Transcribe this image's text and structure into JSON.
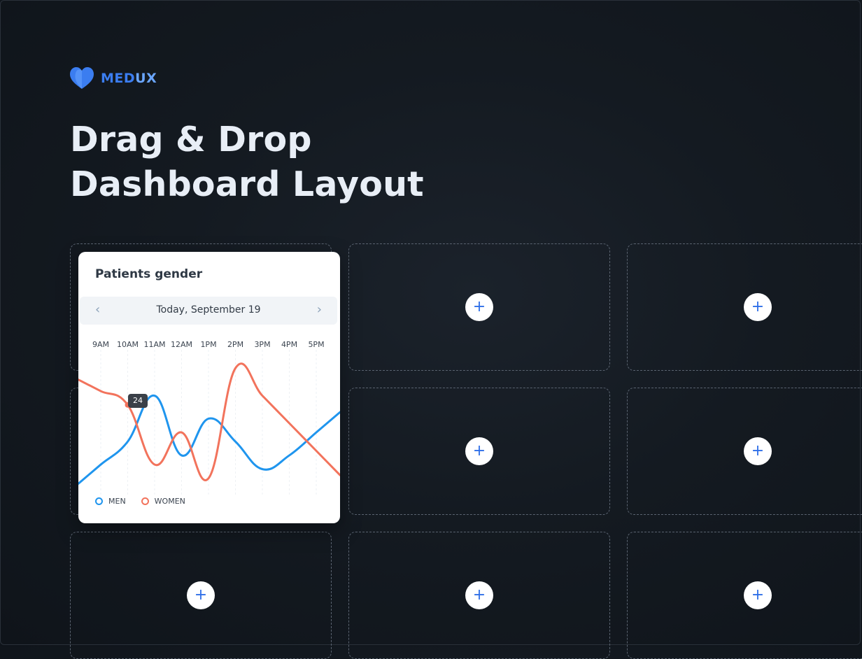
{
  "brand": {
    "name_part1": "MED",
    "name_part2": "UX",
    "icon": "heart-icon"
  },
  "headline": {
    "line1": "Drag & Drop",
    "line2": "Dashboard Layout"
  },
  "add_label": "+",
  "card": {
    "title": "Patients gender",
    "date": "Today, September 19",
    "prev_icon": "chevron-left-icon",
    "next_icon": "chevron-right-icon",
    "tooltip_value": "24"
  },
  "colors": {
    "men": "#1f95ee",
    "women": "#f2735c",
    "accent": "#2f6fe8"
  },
  "chart_data": {
    "type": "line",
    "x": [
      "9AM",
      "10AM",
      "11AM",
      "12AM",
      "1PM",
      "2PM",
      "3PM",
      "4PM",
      "5PM"
    ],
    "series": [
      {
        "name": "MEN",
        "values": [
          7,
          12,
          22,
          9,
          17,
          12,
          6,
          9,
          14
        ]
      },
      {
        "name": "WOMEN",
        "values": [
          23,
          20,
          7,
          14,
          4,
          28,
          22,
          16,
          10
        ]
      }
    ],
    "ylim": [
      0,
      32
    ],
    "annotations": [
      {
        "x": "10AM",
        "series": "WOMEN",
        "value": 24
      }
    ],
    "legend": "bottom-left"
  }
}
